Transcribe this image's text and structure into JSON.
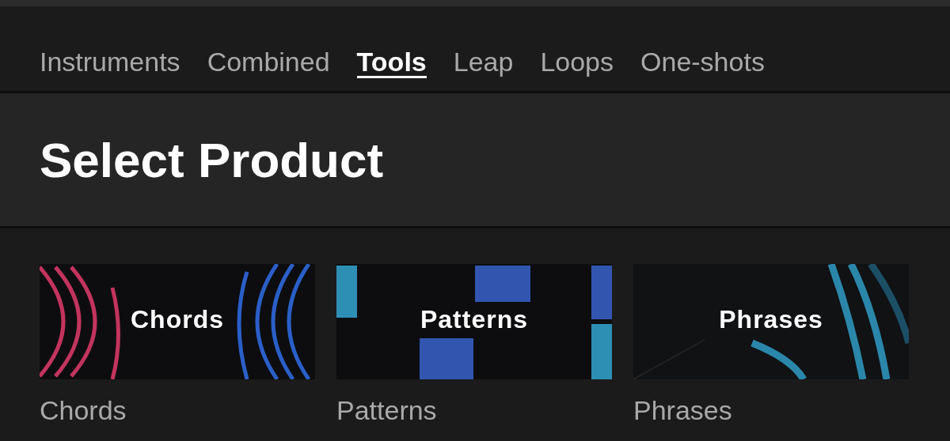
{
  "tabs": [
    {
      "label": "Instruments",
      "selected": false
    },
    {
      "label": "Combined",
      "selected": false
    },
    {
      "label": "Tools",
      "selected": true
    },
    {
      "label": "Leap",
      "selected": false
    },
    {
      "label": "Loops",
      "selected": false
    },
    {
      "label": "One-shots",
      "selected": false
    }
  ],
  "heading": "Select Product",
  "products": [
    {
      "kind": "arcs",
      "artwork_title": "Chords",
      "label": "Chords"
    },
    {
      "kind": "blocks",
      "artwork_title": "Patterns",
      "label": "Patterns"
    },
    {
      "kind": "rings",
      "artwork_title": "Phrases",
      "label": "Phrases"
    }
  ]
}
